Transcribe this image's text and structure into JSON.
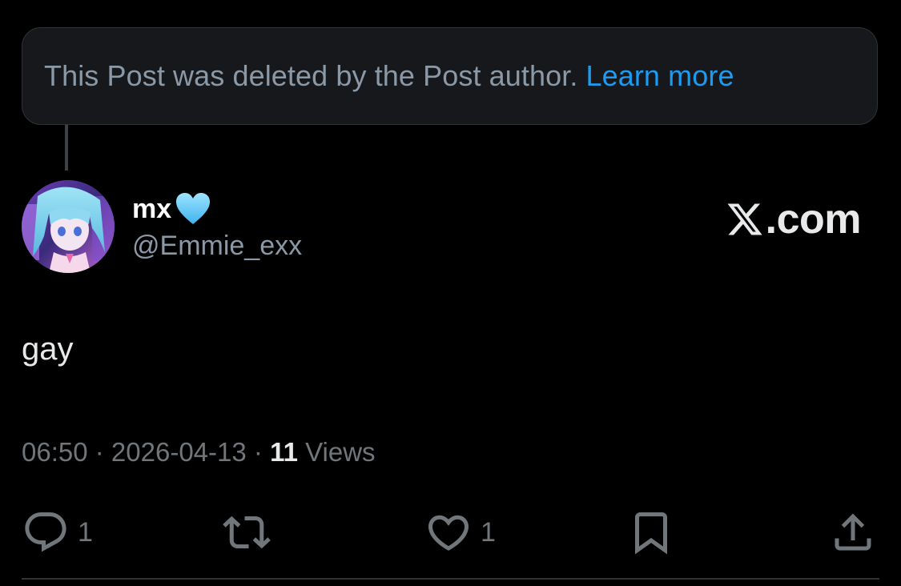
{
  "deleted_notice": {
    "text": "This Post was deleted by the Post author.",
    "link_label": "Learn more"
  },
  "author": {
    "display_name": "mx",
    "name_emoji": "light-blue-heart",
    "handle": "@Emmie_exx",
    "avatar": "anime-avatar"
  },
  "brand": {
    "logo_icon": "x-logo-icon",
    "domain_suffix": ".com"
  },
  "post": {
    "text": "gay"
  },
  "meta": {
    "time": "06:50",
    "separator": " · ",
    "date": "2026-04-13",
    "views_count": "11",
    "views_label": "Views"
  },
  "actions": {
    "reply": {
      "icon": "reply-icon",
      "count": "1"
    },
    "repost": {
      "icon": "repost-icon",
      "count": ""
    },
    "like": {
      "icon": "heart-icon",
      "count": "1"
    },
    "bookmark": {
      "icon": "bookmark-icon",
      "count": ""
    },
    "share": {
      "icon": "share-icon",
      "count": ""
    }
  },
  "colors": {
    "background": "#000000",
    "accent": "#1d9bf0",
    "muted_text": "#71767b",
    "primary_text": "#e7e9ea",
    "card_bg": "#16181c"
  }
}
